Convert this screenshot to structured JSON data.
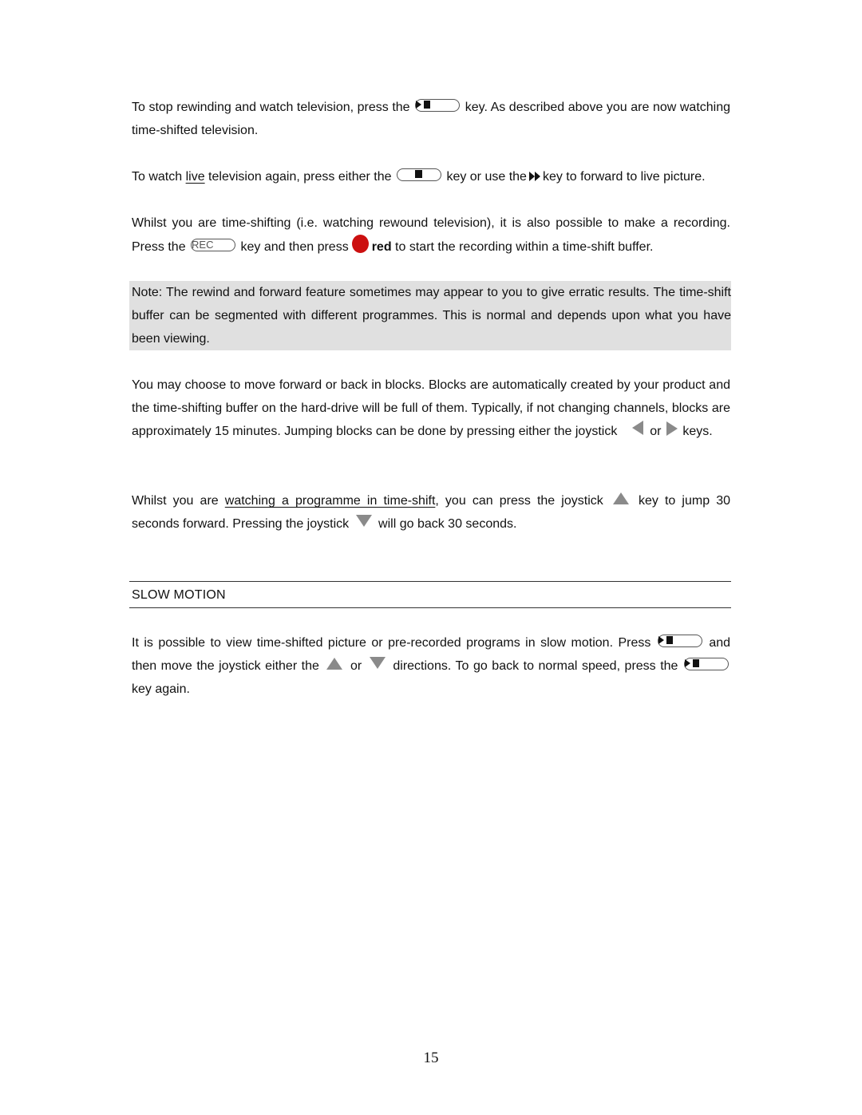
{
  "p1": {
    "a": "To stop rewinding and watch television, press the",
    "b": "key.  As described above you are now watching time-shifted television."
  },
  "p2": {
    "a": "To watch ",
    "live": "live",
    "b": " television again, press either the",
    "c": "key or use the",
    "d": "key to forward to live picture."
  },
  "p3": {
    "a": "Whilst you are time-shifting (i.e. watching rewound television), it is also possible to make a recording. Press the",
    "b": "key and then press",
    "red": "red",
    "c": " to start the recording within a time-shift buffer."
  },
  "note": {
    "text": "Note: The rewind and forward feature sometimes may appear to you to give erratic results.  The time-shift buffer can be segmented with different programmes.  This is normal and depends upon what you have been viewing."
  },
  "p4": {
    "a": "You may choose to move forward or back in blocks.  Blocks are automatically created by your product and the time-shifting buffer on the hard-drive will be full of them.  Typically, if not changing channels, blocks are approximately 15 minutes.  Jumping blocks can be done by pressing either the joystick",
    "b": "or",
    "c": "keys."
  },
  "p5": {
    "a": "Whilst you are ",
    "link": "watching a programme in time-shift",
    "b": ", you can press the joystick",
    "c": "key to jump 30 seconds forward.  Pressing the joystick",
    "d": "will go back 30 seconds."
  },
  "section": {
    "heading": "SLOW MOTION"
  },
  "p6": {
    "a": "It is possible to view time-shifted picture or pre-recorded programs in slow motion.  Press",
    "b": "and then move the joystick either the",
    "c": "or",
    "d": "directions.  To go back to normal speed, press the",
    "e": "key again."
  },
  "keys": {
    "rec_label": "REC"
  },
  "colors": {
    "record_red": "#cc1010",
    "note_bg": "#e0e0e0",
    "joystick_gray": "#8a8a8a"
  },
  "footer": {
    "page_number": "15"
  }
}
